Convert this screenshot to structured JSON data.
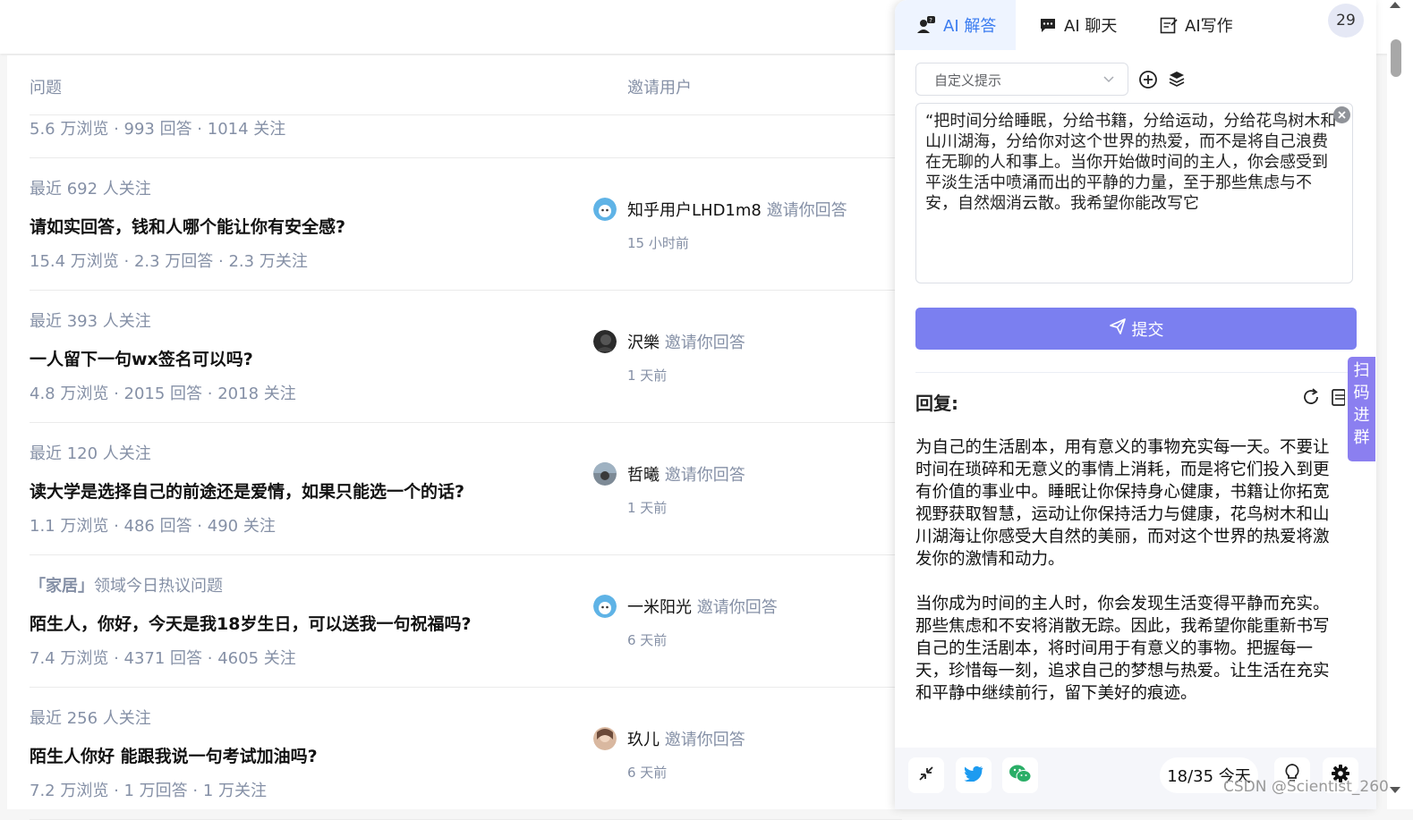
{
  "table": {
    "col_question": "问题",
    "col_inviter": "邀请用户"
  },
  "first_stats": "5.6 万浏览 · 993 回答 · 1014 关注",
  "rows": [
    {
      "reason": "最近 692 人关注",
      "title": "请如实回答，钱和人哪个能让你有安全感?",
      "stats": "15.4 万浏览 · 2.3 万回答 · 2.3 万关注",
      "inviter": "知乎用户LHD1m8",
      "invite_text": "邀请你回答",
      "time": "15 小时前"
    },
    {
      "reason": "最近 393 人关注",
      "title": "一人留下一句wx签名可以吗?",
      "stats": "4.8 万浏览 · 2015 回答 · 2018 关注",
      "inviter": "沢樂",
      "invite_text": "邀请你回答",
      "time": "1 天前"
    },
    {
      "reason": "最近 120 人关注",
      "title": "读大学是选择自己的前途还是爱情，如果只能选一个的话?",
      "stats": "1.1 万浏览 · 486 回答 · 490 关注",
      "inviter": "哲曦",
      "invite_text": "邀请你回答",
      "time": "1 天前"
    },
    {
      "reason_prefix": "「家居」",
      "reason": "领域今日热议问题",
      "title": "陌生人，你好，今天是我18岁生日，可以送我一句祝福吗?",
      "stats": "7.4 万浏览 · 4371 回答 · 4605 关注",
      "inviter": "一米阳光",
      "invite_text": "邀请你回答",
      "time": "6 天前"
    },
    {
      "reason": "最近 256 人关注",
      "title": "陌生人你好 能跟我说一句考试加油吗?",
      "stats": "7.2 万浏览 · 1 万回答 · 1 万关注",
      "inviter": "玖儿",
      "invite_text": "邀请你回答",
      "time": "6 天前"
    }
  ],
  "panel": {
    "tabs": [
      {
        "label": "AI 解答",
        "icon": "ai-answer-icon"
      },
      {
        "label": "AI 聊天",
        "icon": "chat-icon"
      },
      {
        "label": "AI写作",
        "icon": "write-icon"
      }
    ],
    "counter": "29",
    "prompt_select": "自定义提示",
    "prompt_text": "“把时间分给睡眠，分给书籍，分给运动，分给花鸟树木和山川湖海，分给你对这个世界的热爱，而不是将自己浪费在无聊的人和事上。当你开始做时间的主人，你会感受到平淡生活中喷涌而出的平静的力量，至于那些焦虑与不安，自然烟消云散。我希望你能改写它",
    "submit_label": "提交",
    "reply_label": "回复:",
    "reply_paragraphs": [
      "为自己的生活剧本，用有意义的事物充实每一天。不要让时间在琐碎和无意义的事情上消耗，而是将它们投入到更有价值的事业中。睡眠让你保持身心健康，书籍让你拓宽视野获取智慧，运动让你保持活力与健康，花鸟树木和山川湖海让你感受大自然的美丽，而对这个世界的热爱将激发你的激情和动力。",
      "当你成为时间的主人时，你会发现生活变得平静而充实。那些焦虑和不安将消散无踪。因此，我希望你能重新书写自己的生活剧本，将时间用于有意义的事物。把握每一天，珍惜每一刻，追求自己的梦想与热爱。让生活在充实和平静中继续前行，留下美好的痕迹。"
    ],
    "qr_label": "扫码进群",
    "usage": "18/35 今天",
    "accent": "#3b7cf0",
    "submit_color": "#7b7ff0"
  },
  "watermark": "CSDN @Scientist_260"
}
